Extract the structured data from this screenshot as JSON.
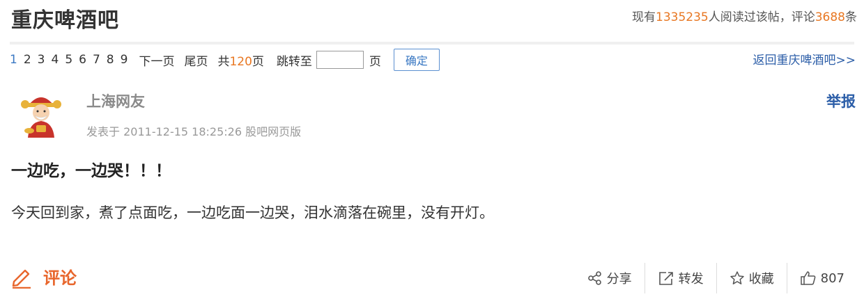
{
  "header": {
    "forum_title": "重庆啤酒吧",
    "stats_prefix": "现有",
    "readers_count": "1335235",
    "stats_mid": "人阅读过该帖，评论",
    "comments_count": "3688",
    "stats_suffix": "条"
  },
  "pager": {
    "pages": [
      "1",
      "2",
      "3",
      "4",
      "5",
      "6",
      "7",
      "8",
      "9"
    ],
    "current_page": "1",
    "next_label": "下一页",
    "last_label": "尾页",
    "total_prefix": "共",
    "total_pages": "120",
    "total_suffix": "页",
    "jump_label": "跳转至",
    "jump_value": "",
    "page_unit": "页",
    "ok_label": "确定",
    "back_link": "返回重庆啤酒吧>>"
  },
  "post": {
    "username": "上海网友",
    "report_label": "举报",
    "meta_prefix": "发表于",
    "timestamp": "2011-12-15 18:25:26",
    "source": "股吧网页版",
    "title": "一边吃，一边哭！！！",
    "body": "今天回到家，煮了点面吃，一边吃面一边哭，泪水滴落在碗里，没有开灯。"
  },
  "actions": {
    "comment_label": "评论",
    "share_label": "分享",
    "forward_label": "转发",
    "favorite_label": "收藏",
    "like_count": "807"
  },
  "colors": {
    "accent_orange": "#e87722",
    "link_blue": "#2c5ea8",
    "comment_orange": "#e8662c"
  },
  "icons": {
    "avatar": "caishen-avatar",
    "comment": "pencil-icon",
    "share": "share-icon",
    "forward": "forward-icon",
    "favorite": "star-icon",
    "like": "thumbs-up-icon"
  }
}
